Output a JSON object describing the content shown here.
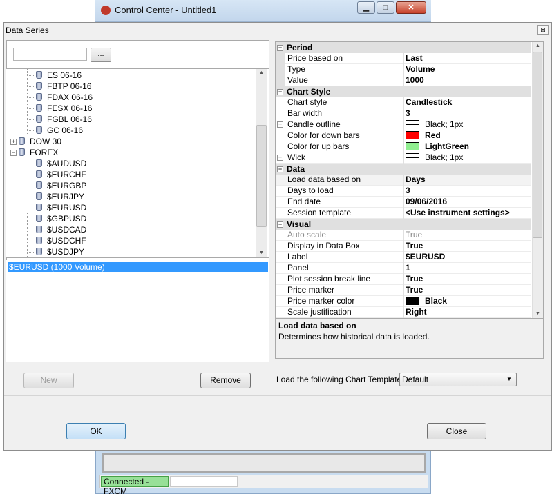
{
  "background_window": {
    "title": "Control Center - Untitled1",
    "status": "Connected - FXCM"
  },
  "dialog": {
    "title": "Data Series",
    "close_glyph": "⊠"
  },
  "instrument_picker": {
    "search_value": "",
    "browse_label": "...",
    "tree": [
      {
        "label": "ES 06-16",
        "level": 2
      },
      {
        "label": "FBTP 06-16",
        "level": 2
      },
      {
        "label": "FDAX 06-16",
        "level": 2
      },
      {
        "label": "FESX 06-16",
        "level": 2
      },
      {
        "label": "FGBL 06-16",
        "level": 2
      },
      {
        "label": "GC 06-16",
        "level": 2
      },
      {
        "label": "DOW 30",
        "level": 1,
        "expander": "+"
      },
      {
        "label": "FOREX",
        "level": 1,
        "expander": "-"
      },
      {
        "label": "$AUDUSD",
        "level": 2
      },
      {
        "label": "$EURCHF",
        "level": 2
      },
      {
        "label": "$EURGBP",
        "level": 2
      },
      {
        "label": "$EURJPY",
        "level": 2
      },
      {
        "label": "$EURUSD",
        "level": 2
      },
      {
        "label": "$GBPUSD",
        "level": 2
      },
      {
        "label": "$USDCAD",
        "level": 2
      },
      {
        "label": "$USDCHF",
        "level": 2
      },
      {
        "label": "$USDJPY",
        "level": 2
      }
    ]
  },
  "series_list": {
    "items": [
      "$EURUSD (1000 Volume)"
    ]
  },
  "buttons": {
    "new": "New",
    "remove": "Remove",
    "ok": "OK",
    "close": "Close"
  },
  "properties": {
    "period": {
      "title": "Period",
      "rows": [
        {
          "name": "Price based on",
          "value": "Last"
        },
        {
          "name": "Type",
          "value": "Volume"
        },
        {
          "name": "Value",
          "value": "1000"
        }
      ]
    },
    "chart_style": {
      "title": "Chart Style",
      "rows": [
        {
          "name": "Chart style",
          "value": "Candlestick"
        },
        {
          "name": "Bar width",
          "value": "3"
        },
        {
          "name": "Candle outline",
          "value": "Black; 1px"
        },
        {
          "name": "Color for down bars",
          "value": "Red"
        },
        {
          "name": "Color for up bars",
          "value": "LightGreen"
        },
        {
          "name": "Wick",
          "value": "Black; 1px"
        }
      ]
    },
    "data": {
      "title": "Data",
      "rows": [
        {
          "name": "Load data based on",
          "value": "Days"
        },
        {
          "name": "Days to load",
          "value": "3"
        },
        {
          "name": "End date",
          "value": "09/06/2016"
        },
        {
          "name": "Session template",
          "value": "<Use instrument settings>"
        }
      ]
    },
    "visual": {
      "title": "Visual",
      "rows": [
        {
          "name": "Auto scale",
          "value": "True"
        },
        {
          "name": "Display in Data Box",
          "value": "True"
        },
        {
          "name": "Label",
          "value": "$EURUSD"
        },
        {
          "name": "Panel",
          "value": "1"
        },
        {
          "name": "Plot session break line",
          "value": "True"
        },
        {
          "name": "Price marker",
          "value": "True"
        },
        {
          "name": "Price marker color",
          "value": "Black"
        },
        {
          "name": "Scale justification",
          "value": "Right"
        }
      ]
    }
  },
  "description": {
    "title": "Load data based on",
    "text": "Determines how historical data is loaded."
  },
  "template": {
    "label": "Load the following Chart Template:",
    "selected": "Default"
  },
  "colors": {
    "selection": "#3399ff",
    "down_bars": "#ff0000",
    "up_bars": "#90ee90",
    "price_marker": "#000000",
    "status_ok": "#98e098"
  }
}
